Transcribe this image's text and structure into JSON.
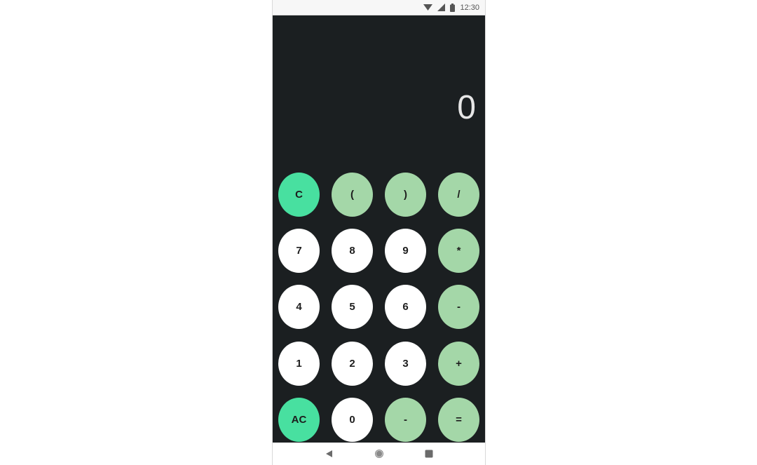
{
  "status_bar": {
    "time": "12:30",
    "icons": [
      "wifi-icon",
      "cell-signal-icon",
      "battery-icon"
    ]
  },
  "display": {
    "value": "0"
  },
  "keypad": {
    "rows": [
      [
        {
          "label": "C",
          "kind": "clear",
          "name": "clear-button"
        },
        {
          "label": "(",
          "kind": "op",
          "name": "open-paren-button"
        },
        {
          "label": ")",
          "kind": "op",
          "name": "close-paren-button"
        },
        {
          "label": "/",
          "kind": "op",
          "name": "divide-button"
        }
      ],
      [
        {
          "label": "7",
          "kind": "num",
          "name": "digit-7-button"
        },
        {
          "label": "8",
          "kind": "num",
          "name": "digit-8-button"
        },
        {
          "label": "9",
          "kind": "num",
          "name": "digit-9-button"
        },
        {
          "label": "*",
          "kind": "op",
          "name": "multiply-button"
        }
      ],
      [
        {
          "label": "4",
          "kind": "num",
          "name": "digit-4-button"
        },
        {
          "label": "5",
          "kind": "num",
          "name": "digit-5-button"
        },
        {
          "label": "6",
          "kind": "num",
          "name": "digit-6-button"
        },
        {
          "label": "-",
          "kind": "op",
          "name": "subtract-button"
        }
      ],
      [
        {
          "label": "1",
          "kind": "num",
          "name": "digit-1-button"
        },
        {
          "label": "2",
          "kind": "num",
          "name": "digit-2-button"
        },
        {
          "label": "3",
          "kind": "num",
          "name": "digit-3-button"
        },
        {
          "label": "+",
          "kind": "op",
          "name": "add-button"
        }
      ],
      [
        {
          "label": "AC",
          "kind": "clear",
          "name": "all-clear-button"
        },
        {
          "label": "0",
          "kind": "num",
          "name": "digit-0-button"
        },
        {
          "label": "-",
          "kind": "op",
          "name": "negate-button"
        },
        {
          "label": "=",
          "kind": "op",
          "name": "equals-button"
        }
      ]
    ]
  },
  "nav_bar": {
    "icons": [
      "back-icon",
      "home-icon",
      "recents-icon"
    ]
  },
  "colors": {
    "background": "#1b1f21",
    "number_key": "#ffffff",
    "operator_key": "#a4d7a8",
    "clear_key": "#48e0a0"
  }
}
